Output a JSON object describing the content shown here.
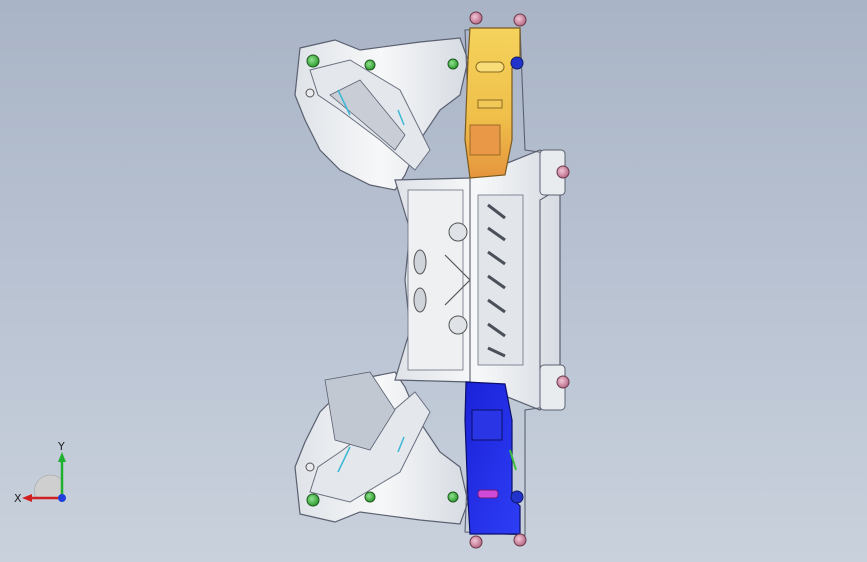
{
  "viewport": {
    "background_top": "#a9b4c6",
    "background_bottom": "#c9d1dc"
  },
  "model": {
    "description_colors": {
      "frame": "#eef0f2",
      "frame_edge": "#5a6070",
      "bracket_top": "#f0c64a",
      "bracket_top_accent": "#e8a24a",
      "bracket_bottom": "#1e2ef0",
      "bolt_green": "#3fbf3f",
      "bolt_pink": "#d48aa6",
      "mount_blue": "#2233cc",
      "gusset_cyan": "#3ab8d6",
      "gusset_magenta": "#c03bd0"
    }
  },
  "triad": {
    "x_label": "X",
    "y_label": "Y",
    "x_color": "#d02020",
    "y_color": "#20b030",
    "z_color": "#1f3fdc"
  }
}
